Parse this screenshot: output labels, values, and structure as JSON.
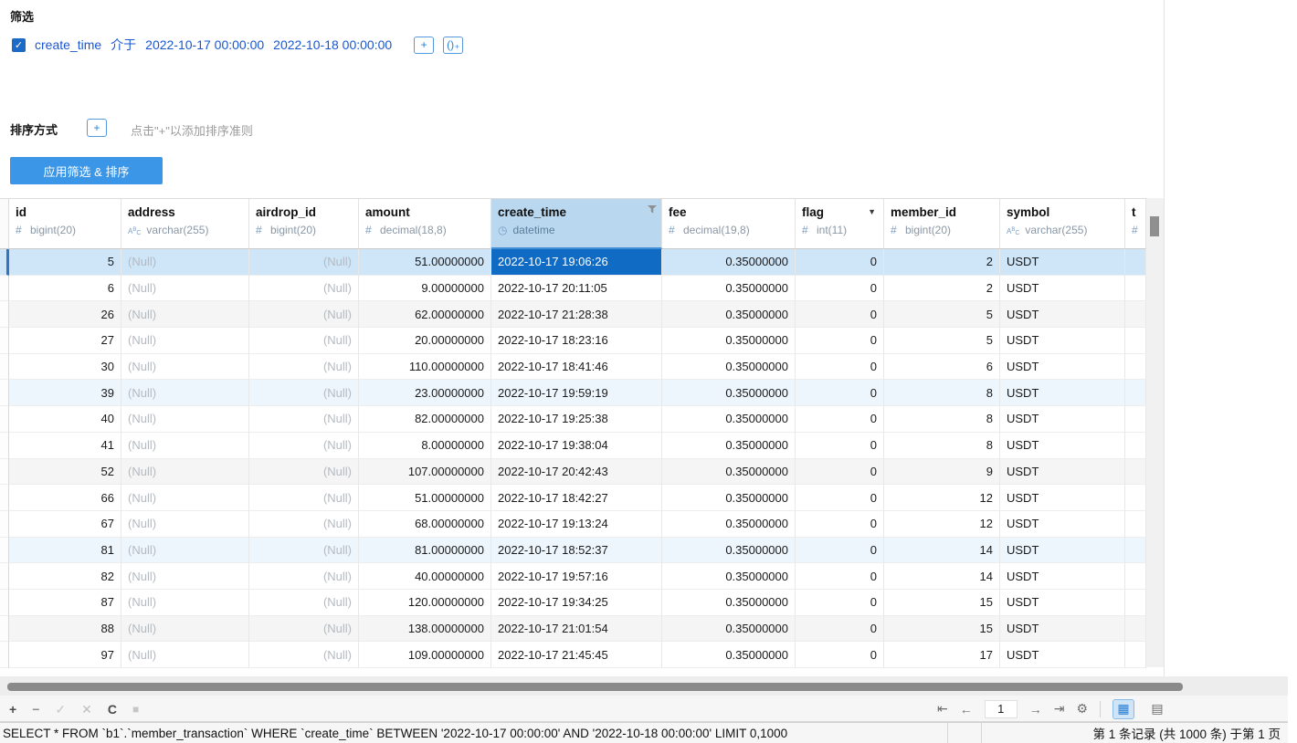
{
  "colors": {
    "accent_blue": "#3b96e7",
    "link_blue": "#1a56d0",
    "selected_cell_blue": "#0f6bc4",
    "selected_row_blue": "#cfe5f8",
    "header_highlight_blue": "#b9d8f0"
  },
  "filter": {
    "title": "筛选",
    "condition": {
      "checked": true,
      "field": "create_time",
      "operator": "介于",
      "value1": "2022-10-17 00:00:00",
      "value2": "2022-10-18 00:00:00"
    },
    "add_label": "+",
    "add_group_label": "()₊"
  },
  "sort": {
    "title": "排序方式",
    "add_label": "+",
    "hint": "点击\"+\"以添加排序准则"
  },
  "apply_button": {
    "label": "应用筛选 & 排序"
  },
  "table": {
    "columns": [
      {
        "name": "id",
        "type": "bigint(20)",
        "icon": "hash",
        "align": "right"
      },
      {
        "name": "address",
        "type": "varchar(255)",
        "icon": "abc",
        "align": "left"
      },
      {
        "name": "airdrop_id",
        "type": "bigint(20)",
        "icon": "hash",
        "align": "right"
      },
      {
        "name": "amount",
        "type": "decimal(18,8)",
        "icon": "hash",
        "align": "right"
      },
      {
        "name": "create_time",
        "type": "datetime",
        "icon": "clock",
        "align": "left",
        "filtered": true,
        "highlighted": true
      },
      {
        "name": "fee",
        "type": "decimal(19,8)",
        "icon": "hash",
        "align": "right"
      },
      {
        "name": "flag",
        "type": "int(11)",
        "icon": "hash",
        "align": "right",
        "dropdown": true
      },
      {
        "name": "member_id",
        "type": "bigint(20)",
        "icon": "hash",
        "align": "right"
      },
      {
        "name": "symbol",
        "type": "varchar(255)",
        "icon": "abc",
        "align": "left"
      },
      {
        "name": "t",
        "type": "",
        "icon": "hash",
        "align": "left",
        "truncated": true
      }
    ],
    "rows": [
      [
        "5",
        "(Null)",
        "(Null)",
        "51.00000000",
        "2022-10-17 19:06:26",
        "0.35000000",
        "0",
        "2",
        "USDT",
        ""
      ],
      [
        "6",
        "(Null)",
        "(Null)",
        "9.00000000",
        "2022-10-17 20:11:05",
        "0.35000000",
        "0",
        "2",
        "USDT",
        ""
      ],
      [
        "26",
        "(Null)",
        "(Null)",
        "62.00000000",
        "2022-10-17 21:28:38",
        "0.35000000",
        "0",
        "5",
        "USDT",
        ""
      ],
      [
        "27",
        "(Null)",
        "(Null)",
        "20.00000000",
        "2022-10-17 18:23:16",
        "0.35000000",
        "0",
        "5",
        "USDT",
        ""
      ],
      [
        "30",
        "(Null)",
        "(Null)",
        "110.00000000",
        "2022-10-17 18:41:46",
        "0.35000000",
        "0",
        "6",
        "USDT",
        ""
      ],
      [
        "39",
        "(Null)",
        "(Null)",
        "23.00000000",
        "2022-10-17 19:59:19",
        "0.35000000",
        "0",
        "8",
        "USDT",
        ""
      ],
      [
        "40",
        "(Null)",
        "(Null)",
        "82.00000000",
        "2022-10-17 19:25:38",
        "0.35000000",
        "0",
        "8",
        "USDT",
        ""
      ],
      [
        "41",
        "(Null)",
        "(Null)",
        "8.00000000",
        "2022-10-17 19:38:04",
        "0.35000000",
        "0",
        "8",
        "USDT",
        ""
      ],
      [
        "52",
        "(Null)",
        "(Null)",
        "107.00000000",
        "2022-10-17 20:42:43",
        "0.35000000",
        "0",
        "9",
        "USDT",
        ""
      ],
      [
        "66",
        "(Null)",
        "(Null)",
        "51.00000000",
        "2022-10-17 18:42:27",
        "0.35000000",
        "0",
        "12",
        "USDT",
        ""
      ],
      [
        "67",
        "(Null)",
        "(Null)",
        "68.00000000",
        "2022-10-17 19:13:24",
        "0.35000000",
        "0",
        "12",
        "USDT",
        ""
      ],
      [
        "81",
        "(Null)",
        "(Null)",
        "81.00000000",
        "2022-10-17 18:52:37",
        "0.35000000",
        "0",
        "14",
        "USDT",
        ""
      ],
      [
        "82",
        "(Null)",
        "(Null)",
        "40.00000000",
        "2022-10-17 19:57:16",
        "0.35000000",
        "0",
        "14",
        "USDT",
        ""
      ],
      [
        "87",
        "(Null)",
        "(Null)",
        "120.00000000",
        "2022-10-17 19:34:25",
        "0.35000000",
        "0",
        "15",
        "USDT",
        ""
      ],
      [
        "88",
        "(Null)",
        "(Null)",
        "138.00000000",
        "2022-10-17 21:01:54",
        "0.35000000",
        "0",
        "15",
        "USDT",
        ""
      ],
      [
        "97",
        "(Null)",
        "(Null)",
        "109.00000000",
        "2022-10-17 21:45:45",
        "0.35000000",
        "0",
        "17",
        "USDT",
        ""
      ]
    ],
    "selected_row": 0,
    "selected_cell_column": "create_time"
  },
  "record_toolbar": {
    "add": "+",
    "delete": "−",
    "apply": "✓",
    "discard": "✕",
    "refresh": "C",
    "stop": "■"
  },
  "pagination": {
    "first": "⇤",
    "prev": "←",
    "page": "1",
    "next": "→",
    "last": "⇥",
    "settings": "⚙",
    "grid_view": "▦",
    "form_view": "▤"
  },
  "sql_bar": {
    "text": "SELECT * FROM `b1`.`member_transaction` WHERE `create_time` BETWEEN '2022-10-17 00:00:00' AND '2022-10-18 00:00:00' LIMIT 0,1000"
  },
  "status_bar": {
    "record_info": "第 1 条记录  (共 1000 条)  于第 1 页"
  }
}
